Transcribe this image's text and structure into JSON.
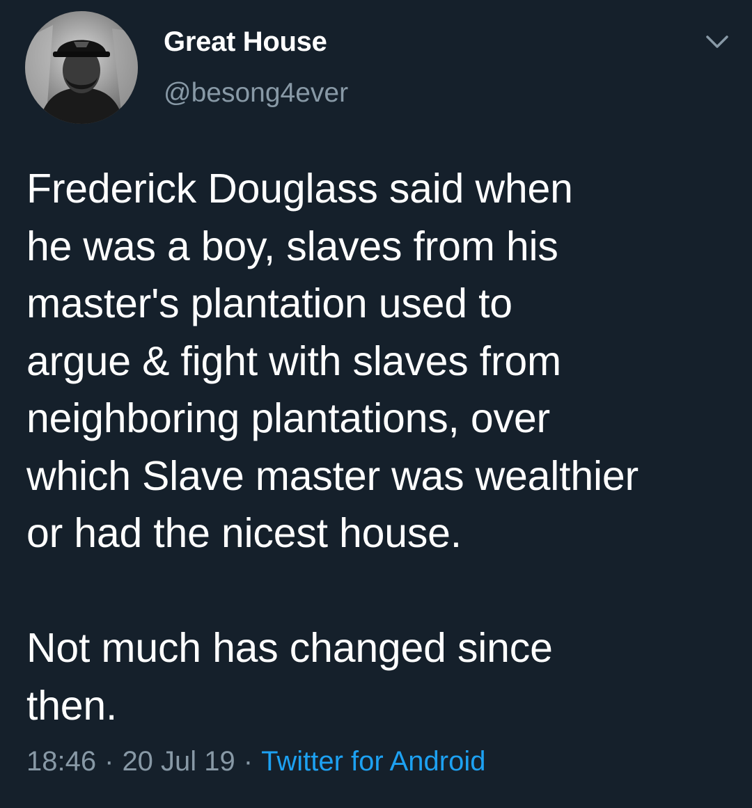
{
  "tweet": {
    "display_name": "Great House",
    "handle": "@besong4ever",
    "text": "Frederick Douglass said when\nhe was a boy, slaves from his\nmaster's plantation used to\nargue & fight with slaves from\nneighboring plantations, over\nwhich Slave master was wealthier\nor had the nicest house.\n\nNot much has changed since\nthen.",
    "time": "18:46",
    "date": "20 Jul 19",
    "separator": "·",
    "source": "Twitter for Android"
  },
  "icons": {
    "menu": "chevron-down-icon",
    "avatar": "avatar"
  },
  "colors": {
    "background": "#15202b",
    "primary_text": "#ffffff",
    "secondary_text": "#8899a6",
    "link": "#1da1f2"
  }
}
